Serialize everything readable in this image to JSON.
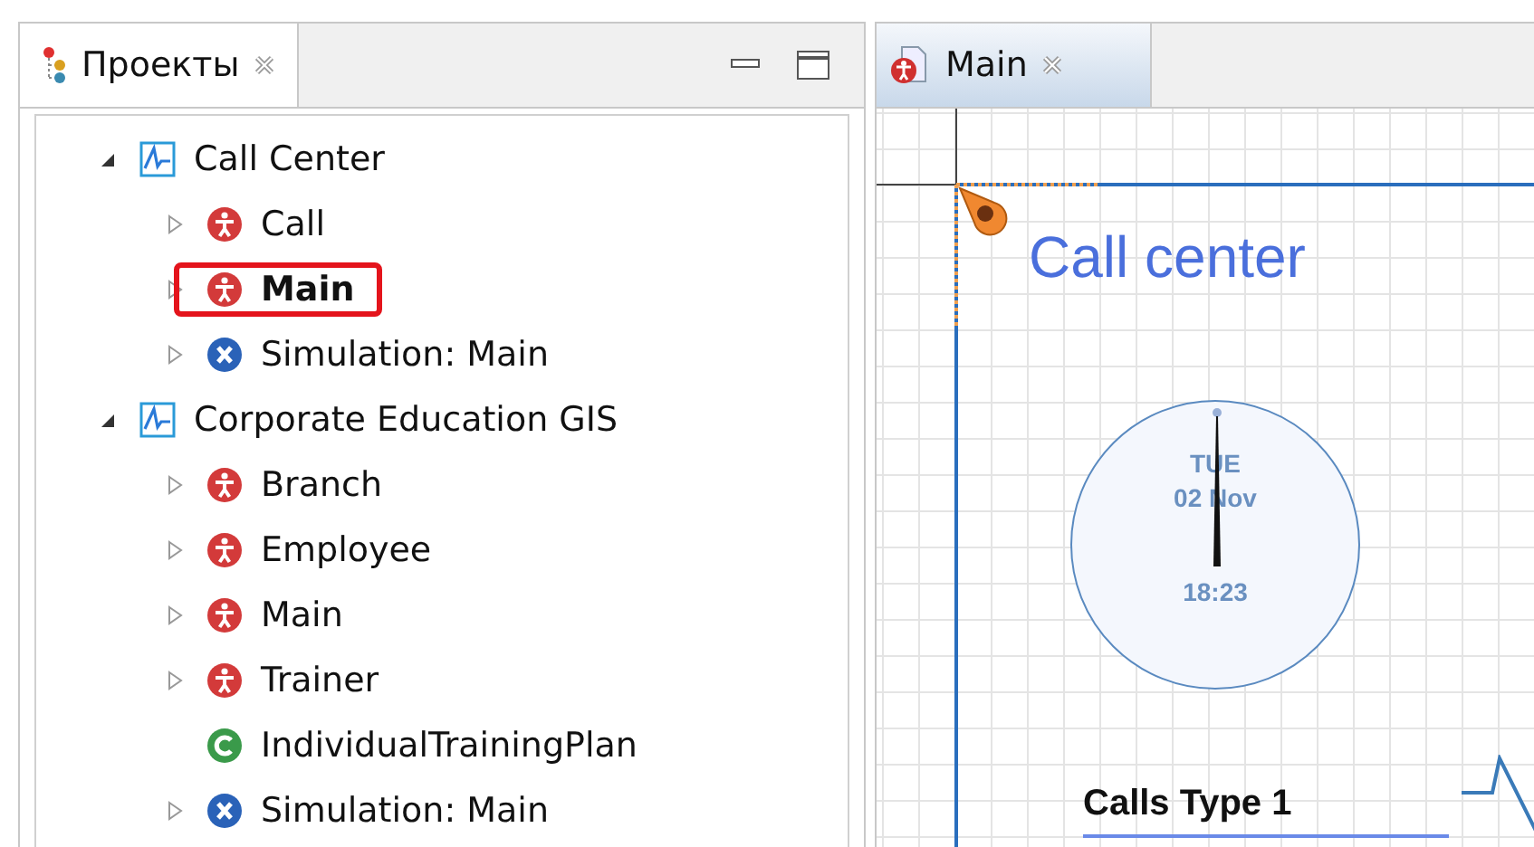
{
  "projects_panel": {
    "title": "Проекты",
    "tree": [
      {
        "label": "Call Center",
        "kind": "project",
        "expanded": true,
        "highlighted": false,
        "children": [
          {
            "label": "Call",
            "kind": "agent",
            "expanded": false,
            "highlighted": false
          },
          {
            "label": "Main",
            "kind": "agent",
            "expanded": false,
            "highlighted": true
          },
          {
            "label": "Simulation: Main",
            "kind": "simulation",
            "expanded": false,
            "highlighted": false
          }
        ]
      },
      {
        "label": "Corporate Education GIS",
        "kind": "project",
        "expanded": true,
        "highlighted": false,
        "children": [
          {
            "label": "Branch",
            "kind": "agent",
            "expanded": false,
            "highlighted": false
          },
          {
            "label": "Employee",
            "kind": "agent",
            "expanded": false,
            "highlighted": false
          },
          {
            "label": "Main",
            "kind": "agent",
            "expanded": false,
            "highlighted": false
          },
          {
            "label": "Trainer",
            "kind": "agent",
            "expanded": false,
            "highlighted": false
          },
          {
            "label": "IndividualTrainingPlan",
            "kind": "class",
            "highlighted": false
          },
          {
            "label": "Simulation: Main",
            "kind": "simulation",
            "expanded": false,
            "highlighted": false
          }
        ]
      }
    ]
  },
  "editor": {
    "tab": "Main",
    "canvas": {
      "title": "Call center",
      "clock": {
        "day": "TUE",
        "date": "02 Nov",
        "time": "18:23"
      },
      "chart_label": "Calls Type 1"
    }
  }
}
